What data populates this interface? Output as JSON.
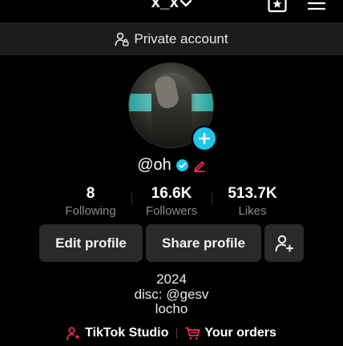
{
  "header": {
    "username": "x_x",
    "favorites_icon": "star-bookmark-icon",
    "menu_icon": "hamburger-menu-icon"
  },
  "privacy": {
    "label": "Private account",
    "icon": "lock-person-icon"
  },
  "profile": {
    "handle": "@oh",
    "verified_icon": "verified-check-icon",
    "edit_icon": "pencil-icon",
    "add_icon": "plus-icon"
  },
  "stats": [
    {
      "value": "8",
      "label": "Following"
    },
    {
      "value": "16.6K",
      "label": "Followers"
    },
    {
      "value": "513.7K",
      "label": "Likes"
    }
  ],
  "actions": {
    "edit_profile": "Edit profile",
    "share_profile": "Share profile",
    "add_friend_icon": "add-friend-icon"
  },
  "bio": {
    "lines": [
      "2024",
      "disc: @gesv",
      "locho"
    ]
  },
  "links": {
    "studio": "TikTok Studio",
    "orders": "Your orders"
  },
  "colors": {
    "background": "#000000",
    "accent_blue": "#20c5e8",
    "accent_red": "#fe2c55",
    "button_bg": "#2a2a2a",
    "muted_text": "#8b8b8b"
  }
}
